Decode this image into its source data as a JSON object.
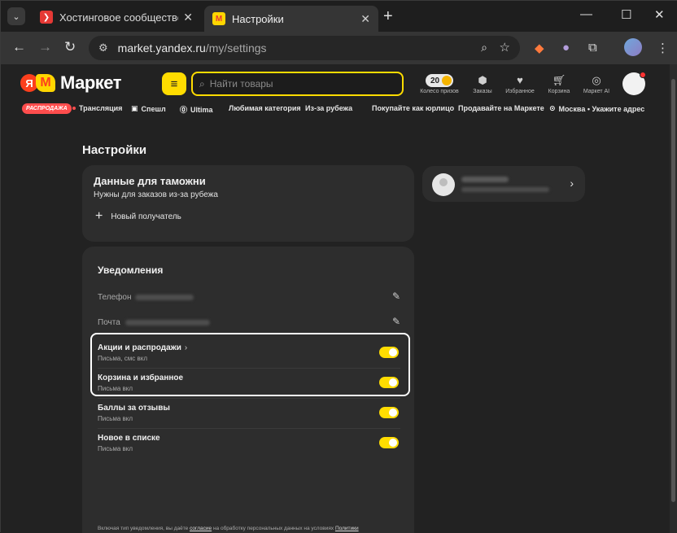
{
  "browser": {
    "tabs": [
      {
        "title": "Хостинговое сообщество «Tim",
        "active": false
      },
      {
        "title": "Настройки",
        "active": true
      }
    ],
    "url_host": "market.yandex.ru",
    "url_path": "/my/settings"
  },
  "header": {
    "logo_ya": "Я",
    "logo_m": "М",
    "logo_word": "Маркет",
    "search_placeholder": "Найти товары",
    "coin_count": "20",
    "items": [
      {
        "label": "Колесо призов",
        "icon": "wheel-icon"
      },
      {
        "label": "Заказы",
        "icon": "orders-icon"
      },
      {
        "label": "Избранное",
        "icon": "heart-icon"
      },
      {
        "label": "Корзина",
        "icon": "cart-icon"
      },
      {
        "label": "Маркет AI",
        "icon": "ai-icon"
      }
    ]
  },
  "subnav": {
    "sale": "РАСПРОДАЖА",
    "items": [
      "Трансляция",
      "Спешл",
      "Ultima",
      "Любимая категория",
      "Из-за рубежа",
      "Покупайте как юрлицо",
      "Продавайте на Маркете",
      "Москва • Укажите адрес"
    ]
  },
  "main": {
    "page_title": "Настройки",
    "customs": {
      "title": "Данные для таможни",
      "subtitle": "Нужны для заказов из-за рубежа",
      "add_label": "Новый получатель"
    },
    "notifications": {
      "title": "Уведомления",
      "phone_label": "Телефон",
      "email_label": "Почта",
      "toggles": [
        {
          "title": "Акции и распродажи",
          "sub": "Письма, смс вкл",
          "on": true
        },
        {
          "title": "Корзина и избранное",
          "sub": "Письма вкл",
          "on": true
        },
        {
          "title": "Баллы за отзывы",
          "sub": "Письма вкл",
          "on": true
        },
        {
          "title": "Новое в списке",
          "sub": "Письма вкл",
          "on": true
        }
      ],
      "consent_prefix": "Включая тип уведомления, вы даёте ",
      "consent_link": "согласие",
      "consent_middle": " на обработку персональных данных на условиях ",
      "consent_link2": "Политики"
    }
  }
}
